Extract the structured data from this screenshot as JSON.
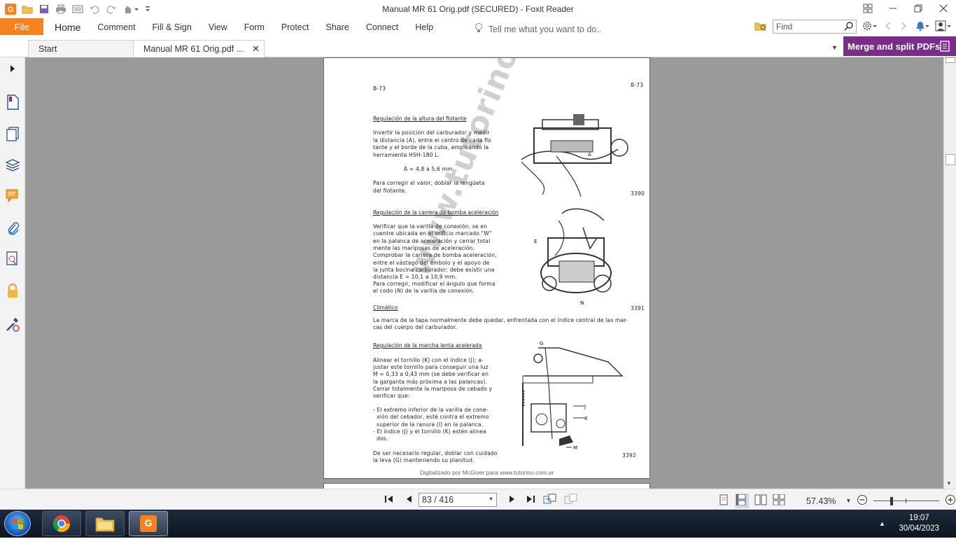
{
  "window": {
    "title": "Manual MR 61 Orig.pdf (SECURED) - Foxit Reader"
  },
  "ribbon": {
    "file_label": "File",
    "tabs": [
      {
        "label": "Home"
      },
      {
        "label": "Comment"
      },
      {
        "label": "Fill & Sign"
      },
      {
        "label": "View"
      },
      {
        "label": "Form"
      },
      {
        "label": "Protect"
      },
      {
        "label": "Share"
      },
      {
        "label": "Connect"
      },
      {
        "label": "Help"
      }
    ],
    "tell_me": "Tell me what you want to do..",
    "find_placeholder": "Find"
  },
  "doc_tabs": {
    "start_label": "Start",
    "doc_label": "Manual MR 61 Orig.pdf ...",
    "close_glyph": "✕"
  },
  "merge_banner": "Merge and split PDFs",
  "page": {
    "page_code_left": "B-73",
    "page_code_right": "B-73",
    "watermark": "www.tutorino.com.ar",
    "footer": "Digitalizado por McGiver para www.tutorino.com.ar",
    "sections": [
      {
        "heading": "Regulación de la altura del flotante",
        "lines": [
          "Invertir la posición del carburador y medir",
          "la distancia (A), entre el centro de cada flo",
          "tante y el borde de la cuba, empleando la",
          "herramienta HSH-180 L."
        ],
        "formula": "A = 4,8 a 5,6 mm",
        "after": [
          "Para corregir el valor, doblar la lengüeta",
          "del flotante."
        ],
        "figure": "3390"
      },
      {
        "heading": "Regulación de la carrera de bomba aceleración",
        "lines": [
          "Verificar que la varilla de conexión, se en",
          "cuentre ubicada en el orificio marcado \"W\"",
          "en la palanca de aceleración y cerrar total",
          "mente las mariposas de aceleración.",
          "Comprobar la carrera de bomba aceleración,",
          "entre el vástago del émbolo y el apoyo de",
          "la junta bocina carburador; debe existir una",
          "distancia E = 10,1 a 10,9 mm.",
          "Para corregir, modificar el ángulo que forma",
          "el codo (N) de la varilla de conexión."
        ],
        "figure": "3391"
      },
      {
        "heading": "Climático",
        "lines": [
          "La marca de la tapa normalmente debe quedar, enfrentada con el índice central de las mar-",
          "cas del cuerpo del carburador."
        ]
      },
      {
        "heading": "Regulación de la marcha lenta acelerada",
        "lines": [
          "Alinear el tornillo (K) con el índice (J); a-",
          "justar este tornillo para conseguir una luz",
          "M = 0,33 a 0,43 mm (se debe verificar en",
          "la garganta más próxima a las palancas).",
          "Cerrar totalmente la mariposa de cebado y",
          "verificar que:",
          "",
          "- El extremo inferior de la varilla de cone-",
          "  xión del cebador, esté contra el extremo",
          "  superior de la ranura (I) en la palanca.",
          "- El índice (J) y el tornillo (K) estén alinea",
          "  dos.",
          "",
          "De ser necesario regular, doblar con cuidado",
          "la leva (G) manteniendo su planitud."
        ],
        "figure": "3392"
      }
    ],
    "fig_labels": {
      "a": "A",
      "e": "E",
      "n": "N",
      "g": "G",
      "j": "J",
      "k": "K",
      "m": "M"
    }
  },
  "status": {
    "page_display": "83 / 416",
    "zoom": "57.43%"
  },
  "taskbar": {
    "time": "19:07",
    "date": "30/04/2023"
  }
}
